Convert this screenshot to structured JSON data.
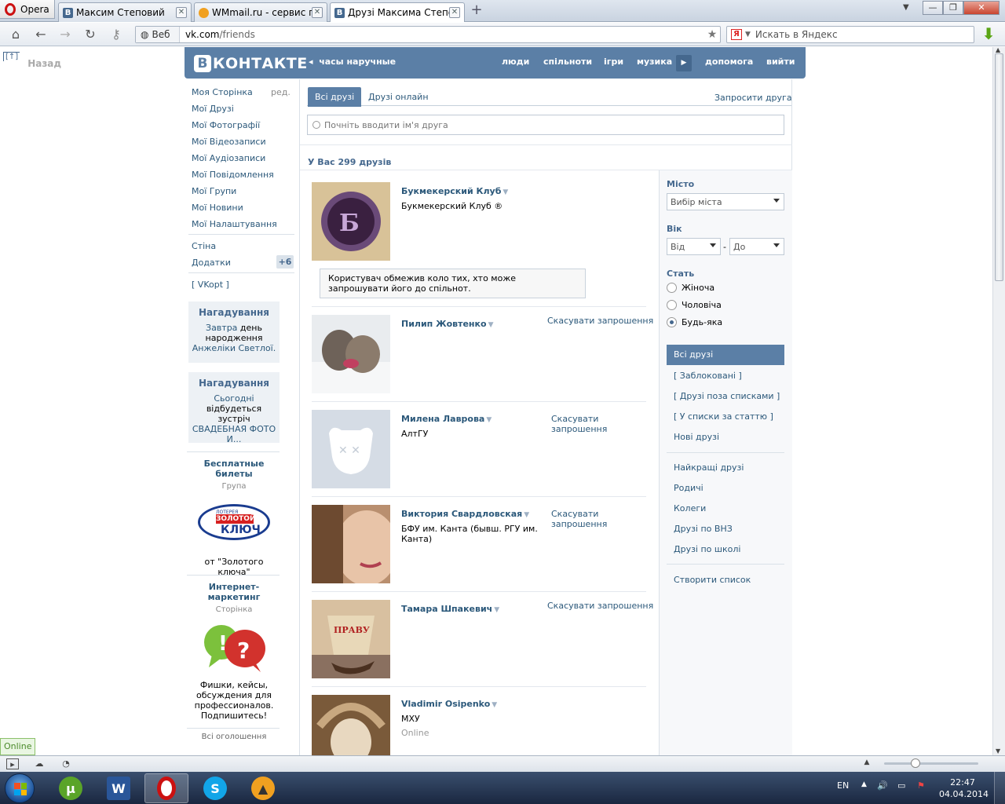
{
  "browser": {
    "menu_label": "Opera",
    "tabs": [
      {
        "label": "Максим Степовий",
        "icon": "vk-favicon"
      },
      {
        "label": "WMmail.ru - сервис п...",
        "icon": "wmmail-favicon"
      },
      {
        "label": "Друзі Максима Степо...",
        "icon": "vk-favicon",
        "active": true
      }
    ],
    "address": {
      "scheme_label": "Веб",
      "host": "vk.com",
      "path": "/friends"
    },
    "search_placeholder": "Искать в Яндекс",
    "search_engine_icon": "Я"
  },
  "page_back": {
    "icon": "[↑]",
    "label": "Назад"
  },
  "vk_header": {
    "logo_letter": "В",
    "logo_word": "КОНТАКТЕ",
    "status": "часы наручные",
    "menu": [
      "люди",
      "спільноти",
      "ігри",
      "музика",
      "допомога",
      "вийти"
    ],
    "brand_color": "#5b7fa6"
  },
  "left_menu": {
    "items": [
      "Моя Сторінка",
      "Мої Друзі",
      "Мої Фотографії",
      "Мої Відеозаписи",
      "Мої Аудіозаписи",
      "Мої Повідомлення",
      "Мої Групи",
      "Мої Новини",
      "Мої Налаштування"
    ],
    "edit_label": "ред.",
    "extra": [
      "Стіна",
      "Додатки",
      "[ VKopt ]"
    ],
    "apps_badge": "+6"
  },
  "reminders": [
    {
      "title": "Нагадування",
      "line1_link": "Завтра",
      "line1_text": " день народження",
      "line2_link": "Анжеліки Светлої."
    },
    {
      "title": "Нагадування",
      "line1_link": "Сьогодні",
      "line1_text": "відбудеться зустріч",
      "line2_link": "СВАДЕБНАЯ ФОТО И..."
    }
  ],
  "ads": [
    {
      "title": "Бесплатные билеты",
      "sub": "Група",
      "logo_top": "ЛОТЕРЕЯ",
      "logo_mid": "ЗОЛОТОЙ",
      "logo_bot": "КЛЮЧ",
      "caption": "от \"Золотого ключа\""
    },
    {
      "title": "Интернет-маркетинг",
      "sub": "Сторінка",
      "caption": "Фишки, кейсы, обсуждения для профессионалов. Подпишитесь!"
    }
  ],
  "all_ads": "Всі оголошення",
  "friends": {
    "tabs": [
      "Всі друзі",
      "Друзі онлайн"
    ],
    "request_link": "Запросити друга",
    "search_placeholder": "Почніть вводити ім'я друга",
    "count_text": "У Вас 299 друзів",
    "rows": [
      {
        "name": "Букмекерский Клуб",
        "sub": "Букмекерский Клуб ®",
        "action": "",
        "online": ""
      },
      {
        "name": "Пилип Жовтенко",
        "sub": "",
        "action": "Скасувати запрошення",
        "online": ""
      },
      {
        "name": "Милена Лаврова",
        "sub": "АлтГУ",
        "action": "Скасувати запрошення",
        "online": ""
      },
      {
        "name": "Виктория Свардловская",
        "sub": "БФУ им. Канта (бывш. РГУ им. Канта)",
        "action": "Скасувати запрошення",
        "online": ""
      },
      {
        "name": "Тамара Шпакевич",
        "sub": "",
        "action": "Скасувати запрошення",
        "online": ""
      },
      {
        "name": "Vladimir Osipenko",
        "sub": "МХУ",
        "action": "",
        "online": "Online"
      }
    ],
    "notice": "Користувач обмежив коло тих, хто може запрошувати його до спільнот."
  },
  "filters": {
    "city_label": "Місто",
    "city_placeholder": "Вибір міста",
    "age_label": "Вік",
    "age_from": "Від",
    "age_dash": "-",
    "age_to": "До",
    "sex_label": "Стать",
    "sex_options": [
      "Жіноча",
      "Чоловіча",
      "Будь-яка"
    ],
    "sex_selected": "Будь-яка",
    "lists": [
      "Всі друзі",
      "[ Заблоковані ]",
      "[ Друзі поза списками ]",
      "[ У списки за статтю ]",
      "Нові друзі"
    ],
    "lists2": [
      "Найкращі друзі",
      "Родичі",
      "Колеги",
      "Друзі по ВНЗ",
      "Друзі по школі"
    ],
    "create_list": "Створити список"
  },
  "online_badge": "Online",
  "taskbar": {
    "lang": "EN",
    "time": "22:47",
    "date": "04.04.2014"
  }
}
